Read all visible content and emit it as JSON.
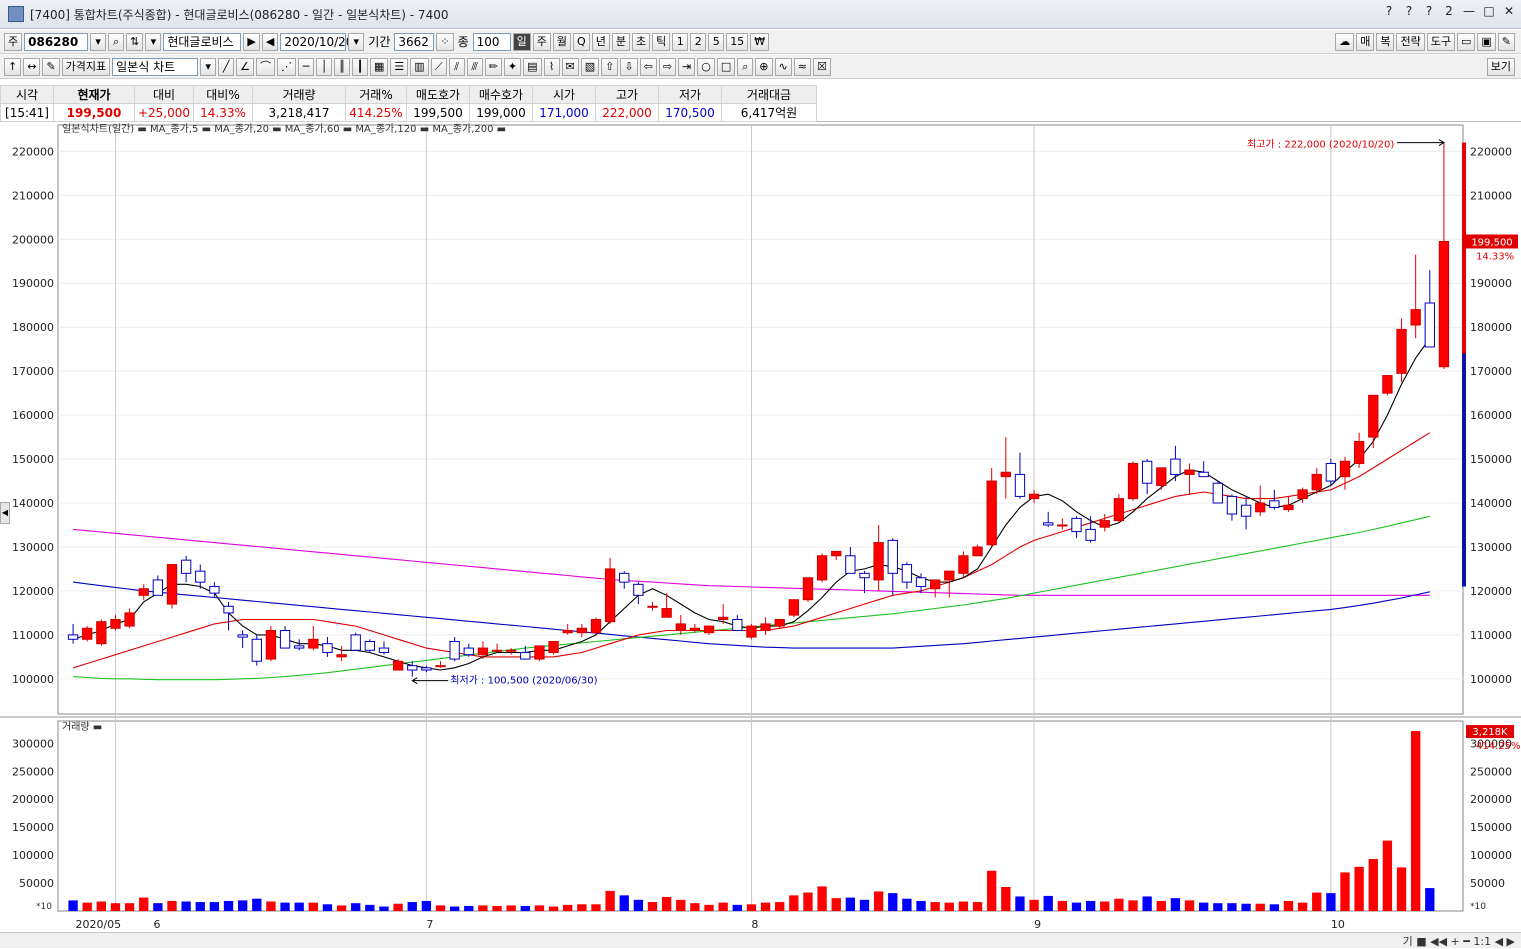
{
  "window": {
    "title": "[7400] 통합차트(주식종합) - 현대글로비스(086280 - 일간 - 일본식차트) - 7400",
    "controls": [
      "?",
      "?",
      "?",
      "2",
      "—",
      "□",
      "✕"
    ]
  },
  "toolbar1": {
    "type_btn": "주",
    "code": "086280",
    "name": "현대글로비스",
    "date": "2020/10/20",
    "period_label": "기간",
    "period_value": "3662",
    "count_label": "종",
    "count_value": "100",
    "periods": [
      "일",
      "주",
      "월",
      "Q",
      "년",
      "분",
      "초",
      "틱",
      "1",
      "2",
      "5",
      "15",
      "₩"
    ],
    "active_period": "일",
    "right": [
      "매",
      "복",
      "전략",
      "도구"
    ]
  },
  "toolbar2": {
    "indicator_btn": "가격지표",
    "chart_type": "일본식 차트",
    "view_btn": "보기"
  },
  "quote": {
    "headers": [
      "시각",
      "현재가",
      "대비",
      "대비%",
      "거래량",
      "거래%",
      "매도호가",
      "매수호가",
      "시가",
      "고가",
      "저가",
      "거래대금"
    ],
    "values": [
      "[15:41]",
      "199,500",
      "+25,000",
      "14.33%",
      "3,218,417",
      "414.25%",
      "199,500",
      "199,000",
      "171,000",
      "222,000",
      "170,500",
      "6,417억원"
    ]
  },
  "chart_data": {
    "type": "candlestick",
    "legend": "일본식차트(일간) ▬ MA_종가,5 ▬ MA_종가,20 ▬ MA_종가,60 ▬ MA_종가,120 ▬ MA_종가,200 ▬",
    "ylim": [
      92000,
      226000
    ],
    "yticks": [
      100000,
      110000,
      120000,
      130000,
      140000,
      150000,
      160000,
      170000,
      180000,
      190000,
      200000,
      210000,
      220000
    ],
    "ytick_labels": [
      "100000",
      "110000",
      "120000",
      "130000",
      "140000",
      "150000",
      "160000",
      "170000",
      "180000",
      "190000",
      "200000",
      "210000",
      "220000"
    ],
    "month_labels": [
      {
        "i": 3,
        "t": "2020/05"
      },
      {
        "i": 25,
        "t": "6"
      },
      {
        "i": 48,
        "t": "7"
      },
      {
        "i": 68,
        "t": "8"
      },
      {
        "i": 89,
        "t": "9"
      }
    ],
    "x_month_text": [
      "2020/05",
      "6",
      "7",
      "8",
      "9",
      "10"
    ],
    "ohlc": [
      [
        110000,
        112500,
        108000,
        109000
      ],
      [
        109000,
        112000,
        108500,
        111500
      ],
      [
        108000,
        113500,
        107500,
        113000
      ],
      [
        111500,
        114500,
        111000,
        113500
      ],
      [
        112000,
        116000,
        111500,
        115000
      ],
      [
        119000,
        121500,
        118000,
        120500
      ],
      [
        122500,
        123500,
        119000,
        119000
      ],
      [
        117000,
        122000,
        116000,
        126000
      ],
      [
        127000,
        128000,
        122000,
        124000
      ],
      [
        124500,
        126000,
        120500,
        122000
      ],
      [
        121000,
        122000,
        118500,
        119500
      ],
      [
        116500,
        117500,
        111000,
        115000
      ],
      [
        110000,
        111000,
        107000,
        109500
      ],
      [
        109000,
        110000,
        103000,
        104000
      ],
      [
        104500,
        112000,
        104000,
        111000
      ],
      [
        111000,
        112000,
        107000,
        107000
      ],
      [
        107500,
        109000,
        106500,
        107000
      ],
      [
        107000,
        112000,
        106500,
        109000
      ],
      [
        108000,
        109500,
        105000,
        106000
      ],
      [
        105000,
        107500,
        104000,
        105500
      ],
      [
        110000,
        110500,
        106500,
        106500
      ],
      [
        108500,
        109000,
        106000,
        106500
      ],
      [
        107000,
        108500,
        105500,
        106000
      ],
      [
        102000,
        104500,
        102000,
        104000
      ],
      [
        103000,
        104000,
        100500,
        102000
      ],
      [
        102500,
        103000,
        101500,
        102000
      ],
      [
        103000,
        104000,
        102500,
        103000
      ],
      [
        108500,
        109500,
        104000,
        104500
      ],
      [
        107000,
        108000,
        105000,
        105500
      ],
      [
        105500,
        108500,
        104500,
        107000
      ],
      [
        106500,
        108000,
        106000,
        106500
      ],
      [
        106500,
        107000,
        105500,
        106500
      ],
      [
        106000,
        107500,
        104500,
        104500
      ],
      [
        104500,
        107500,
        104000,
        107500
      ],
      [
        106000,
        108500,
        105500,
        108500
      ],
      [
        110500,
        112500,
        110000,
        111000
      ],
      [
        110500,
        112500,
        109500,
        111500
      ],
      [
        110500,
        114000,
        110000,
        113500
      ],
      [
        113000,
        127500,
        112500,
        125000
      ],
      [
        124000,
        124500,
        120500,
        122000
      ],
      [
        121500,
        122000,
        117000,
        119000
      ],
      [
        116500,
        117500,
        115500,
        116500
      ],
      [
        114000,
        119500,
        114000,
        116000
      ],
      [
        111000,
        114500,
        110000,
        112500
      ],
      [
        111000,
        112500,
        110500,
        111500
      ],
      [
        110500,
        112000,
        110000,
        112000
      ],
      [
        113500,
        117000,
        112500,
        114000
      ],
      [
        113500,
        114500,
        111000,
        111000
      ],
      [
        109500,
        112500,
        109000,
        112000
      ],
      [
        111000,
        114000,
        110000,
        112500
      ],
      [
        112000,
        113500,
        111500,
        113500
      ],
      [
        114500,
        118000,
        114000,
        118000
      ],
      [
        118000,
        123000,
        117500,
        123000
      ],
      [
        122500,
        128500,
        122000,
        128000
      ],
      [
        128000,
        129000,
        127000,
        129000
      ],
      [
        128000,
        130000,
        125500,
        124000
      ],
      [
        124000,
        124500,
        119500,
        123000
      ],
      [
        122500,
        135000,
        120000,
        131000
      ],
      [
        131500,
        132000,
        119000,
        124000
      ],
      [
        126000,
        126500,
        120500,
        122000
      ],
      [
        123000,
        124000,
        119500,
        121000
      ],
      [
        120500,
        121500,
        118500,
        122500
      ],
      [
        122500,
        123500,
        118500,
        124500
      ],
      [
        124000,
        129000,
        123000,
        128000
      ],
      [
        128000,
        130500,
        128000,
        130000
      ],
      [
        130500,
        148000,
        130000,
        145000
      ],
      [
        146000,
        155000,
        141000,
        147000
      ],
      [
        146500,
        151500,
        141000,
        141500
      ],
      [
        141000,
        143000,
        140000,
        142000
      ],
      [
        135500,
        138000,
        134500,
        135000
      ],
      [
        135000,
        136500,
        134000,
        135000
      ],
      [
        136500,
        137000,
        132000,
        133500
      ],
      [
        134000,
        137000,
        131000,
        131500
      ],
      [
        134500,
        137500,
        133500,
        136000
      ],
      [
        136000,
        142000,
        135500,
        141000
      ],
      [
        141000,
        149500,
        140500,
        149000
      ],
      [
        149500,
        150000,
        142000,
        144500
      ],
      [
        144000,
        148000,
        143000,
        148000
      ],
      [
        150000,
        153000,
        145000,
        146500
      ],
      [
        146500,
        149000,
        142000,
        147500
      ],
      [
        147000,
        149500,
        146500,
        146000
      ],
      [
        144500,
        145000,
        140000,
        140000
      ],
      [
        141500,
        142000,
        136000,
        137500
      ],
      [
        139500,
        141500,
        134000,
        137000
      ],
      [
        138000,
        144000,
        137000,
        140000
      ],
      [
        140500,
        143000,
        138500,
        139000
      ],
      [
        138500,
        141500,
        138000,
        139500
      ],
      [
        141000,
        143500,
        140000,
        143000
      ],
      [
        143000,
        148000,
        142000,
        146500
      ],
      [
        149000,
        150000,
        144000,
        145000
      ],
      [
        146000,
        150500,
        143000,
        149500
      ],
      [
        149000,
        156000,
        148000,
        154000
      ],
      [
        155000,
        161000,
        152500,
        164500
      ],
      [
        165000,
        166500,
        164500,
        169000
      ],
      [
        169500,
        182000,
        167500,
        179500
      ],
      [
        180500,
        196500,
        177500,
        184000
      ],
      [
        185500,
        193000,
        175500,
        175500
      ],
      [
        171000,
        222000,
        170500,
        199500
      ]
    ],
    "ma_labels": [
      "MA_종가,5",
      "MA_종가,20",
      "MA_종가,60",
      "MA_종가,120",
      "MA_종가,200"
    ],
    "ma_colors": [
      "#000000",
      "#e00000",
      "#1fc21f",
      "#0000c0",
      "#e000e0"
    ],
    "ma5": [
      109000,
      110000,
      111000,
      112500,
      113500,
      117500,
      119500,
      121500,
      121500,
      121000,
      119500,
      115000,
      112000,
      110000,
      110000,
      109000,
      108000,
      108000,
      107500,
      106500,
      106500,
      106000,
      105000,
      104000,
      103000,
      102500,
      102000,
      102500,
      103500,
      105000,
      106000,
      106000,
      106000,
      106500,
      106500,
      107500,
      108500,
      110000,
      113000,
      116000,
      119000,
      120500,
      119000,
      117000,
      115000,
      113500,
      113000,
      112000,
      111500,
      112000,
      112000,
      113000,
      115500,
      118500,
      122000,
      124500,
      125000,
      126000,
      125500,
      124500,
      123000,
      122000,
      122000,
      123000,
      125000,
      130000,
      135000,
      139000,
      141500,
      142000,
      140500,
      138000,
      136000,
      134500,
      135500,
      138000,
      141000,
      143500,
      146000,
      147500,
      147000,
      145000,
      143000,
      141500,
      140000,
      139000,
      139500,
      141000,
      142500,
      144000,
      147000,
      150000,
      154000,
      160000,
      167000,
      173000,
      177500
    ],
    "ma20": [
      102500,
      103500,
      104500,
      105500,
      106500,
      107500,
      108500,
      109500,
      110500,
      111500,
      112500,
      113000,
      113500,
      113500,
      113500,
      113500,
      113500,
      113500,
      113000,
      112500,
      112000,
      111000,
      110000,
      109000,
      108000,
      107000,
      106500,
      106000,
      105500,
      105000,
      105000,
      105000,
      105000,
      105000,
      105000,
      105500,
      106000,
      107000,
      108000,
      109000,
      110000,
      110500,
      111000,
      111000,
      111000,
      111000,
      111000,
      111000,
      111000,
      111000,
      111500,
      112000,
      113000,
      114000,
      115000,
      116000,
      117000,
      118000,
      119000,
      119500,
      120000,
      121000,
      122000,
      123000,
      124500,
      126000,
      128000,
      130000,
      131500,
      132500,
      133500,
      134500,
      135500,
      136500,
      137500,
      138500,
      139500,
      140500,
      141500,
      142000,
      142500,
      142000,
      141500,
      141000,
      141000,
      141000,
      141500,
      142000,
      142500,
      143000,
      144500,
      146000,
      148000,
      150000,
      152000,
      154000,
      156000
    ],
    "ma60": [
      100500,
      100300,
      100100,
      100000,
      100000,
      99900,
      99800,
      99800,
      99800,
      99800,
      99800,
      99900,
      100000,
      100100,
      100300,
      100500,
      100800,
      101100,
      101400,
      101800,
      102200,
      102600,
      103000,
      103400,
      103800,
      104200,
      104600,
      105000,
      105400,
      105800,
      106200,
      106600,
      107000,
      107300,
      107600,
      107900,
      108200,
      108500,
      108800,
      109100,
      109400,
      109700,
      110000,
      110300,
      110600,
      110900,
      111200,
      111500,
      111800,
      112100,
      112400,
      112700,
      113000,
      113300,
      113600,
      113900,
      114200,
      114500,
      114800,
      115200,
      115600,
      116000,
      116400,
      116800,
      117300,
      117800,
      118300,
      118900,
      119500,
      120100,
      120700,
      121300,
      121900,
      122500,
      123100,
      123700,
      124300,
      124900,
      125500,
      126100,
      126700,
      127300,
      127900,
      128500,
      129100,
      129700,
      130300,
      130900,
      131500,
      132100,
      132700,
      133300,
      134000,
      134700,
      135500,
      136200,
      137000
    ],
    "ma120": [
      122000,
      121600,
      121200,
      120800,
      120400,
      120000,
      119700,
      119400,
      119100,
      118800,
      118500,
      118200,
      117900,
      117600,
      117300,
      117000,
      116700,
      116400,
      116100,
      115800,
      115500,
      115200,
      114900,
      114600,
      114300,
      114000,
      113700,
      113400,
      113100,
      112800,
      112500,
      112200,
      111900,
      111600,
      111300,
      111000,
      110700,
      110400,
      110100,
      109800,
      109500,
      109200,
      108900,
      108600,
      108300,
      108000,
      107800,
      107600,
      107400,
      107200,
      107100,
      107000,
      107000,
      107000,
      107000,
      107000,
      107000,
      107000,
      107000,
      107200,
      107400,
      107600,
      107800,
      108000,
      108300,
      108600,
      108900,
      109200,
      109500,
      109800,
      110100,
      110400,
      110700,
      111000,
      111300,
      111600,
      111900,
      112200,
      112500,
      112800,
      113100,
      113400,
      113700,
      114000,
      114300,
      114600,
      114900,
      115200,
      115500,
      115800,
      116200,
      116700,
      117200,
      117800,
      118400,
      119100,
      119800
    ],
    "ma200": [
      134000,
      133700,
      133400,
      133100,
      132800,
      132500,
      132200,
      131900,
      131600,
      131300,
      131000,
      130700,
      130400,
      130100,
      129800,
      129500,
      129200,
      128900,
      128600,
      128300,
      128000,
      127700,
      127400,
      127100,
      126800,
      126500,
      126200,
      125900,
      125600,
      125300,
      125000,
      124700,
      124400,
      124100,
      123800,
      123500,
      123200,
      122900,
      122600,
      122400,
      122200,
      122000,
      121800,
      121600,
      121400,
      121200,
      121100,
      121000,
      120900,
      120800,
      120700,
      120600,
      120500,
      120400,
      120300,
      120200,
      120100,
      120000,
      119900,
      119800,
      119700,
      119600,
      119500,
      119400,
      119300,
      119200,
      119100,
      119000,
      119000,
      119000,
      119000,
      119000,
      119000,
      119000,
      119000,
      119000,
      119000,
      119000,
      119000,
      119000,
      119000,
      119000,
      119000,
      119000,
      119000,
      119000,
      119000,
      119000,
      119000,
      119000,
      119000,
      119000,
      119000,
      119000,
      119000,
      119000,
      119000
    ],
    "high_annotation": "최고가 : 222,000 (2020/10/20)",
    "low_annotation": "최저가 : 100,500 (2020/06/30)",
    "price_tag": "199,500",
    "price_tag_pct": "14.33%",
    "volume": {
      "label": "거래량",
      "ylim": [
        0,
        340000
      ],
      "yticks": [
        50000,
        100000,
        150000,
        200000,
        250000,
        300000
      ],
      "ytick_labels": [
        "50000",
        "100000",
        "150000",
        "200000",
        "250000",
        "300000"
      ],
      "unit_label": "*10",
      "values": [
        19000,
        15000,
        17000,
        14000,
        14000,
        24000,
        14000,
        18000,
        17000,
        16000,
        16000,
        18000,
        19000,
        22000,
        17000,
        15000,
        15000,
        15000,
        12000,
        10000,
        14000,
        11000,
        8000,
        13000,
        16000,
        18000,
        10000,
        8000,
        9000,
        10000,
        9000,
        10000,
        9000,
        10000,
        8000,
        11000,
        12000,
        12000,
        36000,
        28000,
        20000,
        16000,
        25000,
        20000,
        14000,
        11000,
        15000,
        11000,
        12000,
        15000,
        16000,
        28000,
        33000,
        44000,
        23000,
        24000,
        20000,
        35000,
        32000,
        22000,
        18000,
        16000,
        15000,
        17000,
        16000,
        72000,
        43000,
        26000,
        20000,
        27000,
        18000,
        15000,
        18000,
        17000,
        22000,
        19000,
        26000,
        18000,
        23000,
        19000,
        15000,
        14000,
        14000,
        13000,
        13000,
        12000,
        18000,
        15000,
        33000,
        32000,
        69000,
        79000,
        93000,
        126000,
        78000,
        322000,
        41000
      ],
      "tag": "3,218K",
      "tag_pct": "414.25%"
    }
  },
  "statusbar": {
    "items": "기 ■ ◀◀ + ━ 1:1 ◀ ▶"
  }
}
